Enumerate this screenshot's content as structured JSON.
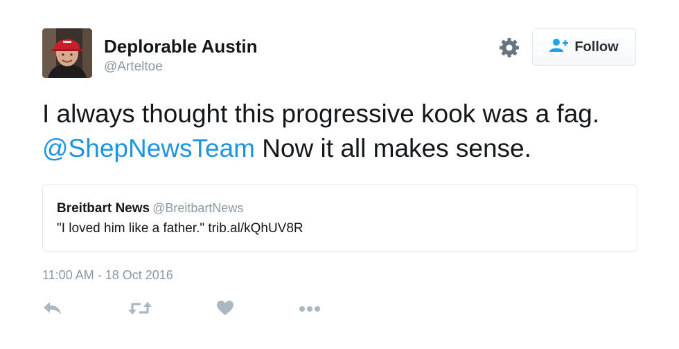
{
  "author": {
    "display_name": "Deplorable Austin",
    "handle": "@Arteltoe"
  },
  "header_actions": {
    "follow_label": "Follow",
    "settings_icon": "gear-icon",
    "follow_icon": "add-user-icon"
  },
  "tweet": {
    "text_before": "I always thought this progressive kook  was a fag. ",
    "mention": "@ShepNewsTeam",
    "text_after": " Now it all makes sense.",
    "timestamp": "11:00 AM - 18 Oct 2016"
  },
  "quoted_tweet": {
    "name": "Breitbart News",
    "handle": "@BreitbartNews",
    "text": "\"I loved him like a father.\" trib.al/kQhUV8R"
  },
  "actions": [
    {
      "icon": "reply-icon"
    },
    {
      "icon": "retweet-icon"
    },
    {
      "icon": "like-icon"
    },
    {
      "icon": "more-icon"
    }
  ],
  "colors": {
    "text": "#14171a",
    "muted": "#8899a6",
    "link": "#1b95e0",
    "action_icons": "#aab8c2",
    "border": "#e1e8ed"
  }
}
